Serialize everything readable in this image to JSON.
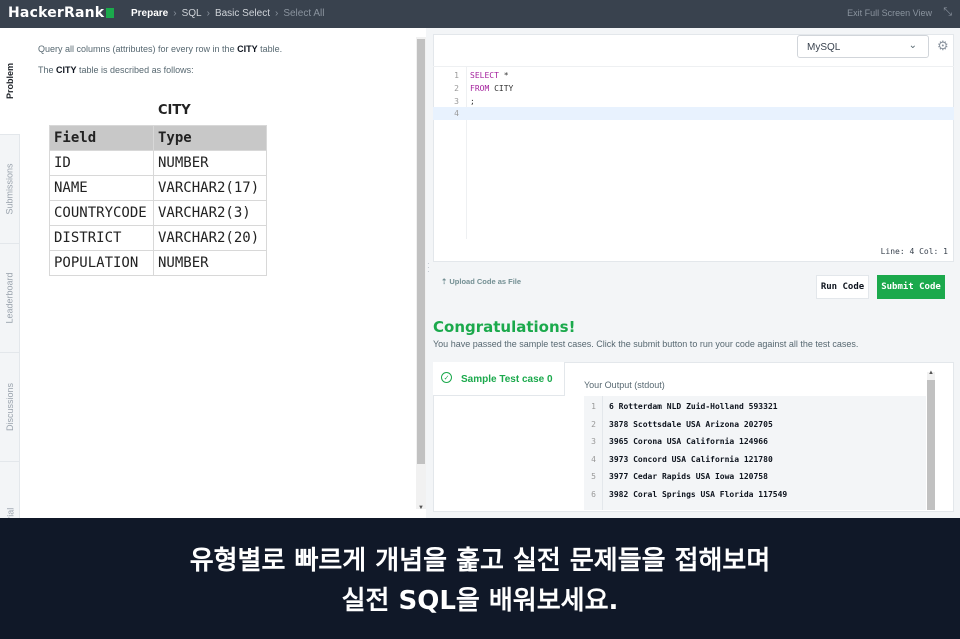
{
  "topbar": {
    "logo": "HackerRank",
    "breadcrumbs": [
      "Prepare",
      "SQL",
      "Basic Select",
      "Select All"
    ],
    "exit_label": "Exit Full Screen View"
  },
  "side_tabs": [
    "Problem",
    "Submissions",
    "Leaderboard",
    "Discussions",
    "Editorial"
  ],
  "problem": {
    "line1_pre": "Query all columns (attributes) for every row in the ",
    "line1_bold": "CITY",
    "line1_post": " table.",
    "line2_pre": "The ",
    "line2_bold": "CITY",
    "line2_post": " table is described as follows:",
    "table_title": "CITY",
    "columns": [
      "Field",
      "Type"
    ],
    "rows": [
      [
        "ID",
        "NUMBER"
      ],
      [
        "NAME",
        "VARCHAR2(17)"
      ],
      [
        "COUNTRYCODE",
        "VARCHAR2(3)"
      ],
      [
        "DISTRICT",
        "VARCHAR2(20)"
      ],
      [
        "POPULATION",
        "NUMBER"
      ]
    ]
  },
  "editor": {
    "language": "MySQL",
    "lines": [
      {
        "n": "1",
        "kw": "SELECT",
        "rest": " *"
      },
      {
        "n": "2",
        "kw": "FROM",
        "rest": " CITY"
      },
      {
        "n": "3",
        "kw": "",
        "rest": ";"
      },
      {
        "n": "4",
        "kw": "",
        "rest": ""
      }
    ],
    "status": "Line: 4 Col: 1",
    "upload_label": "Upload Code as File",
    "run_label": "Run Code",
    "submit_label": "Submit Code"
  },
  "result": {
    "title": "Congratulations!",
    "subtitle": "You have passed the sample test cases. Click the submit button to run your code against all the test cases.",
    "case_label": "Sample Test case 0",
    "output_label": "Your Output (stdout)",
    "output_lines": [
      {
        "n": "1",
        "text": "6 Rotterdam NLD Zuid-Holland 593321"
      },
      {
        "n": "2",
        "text": "3878 Scottsdale USA Arizona 202705"
      },
      {
        "n": "3",
        "text": "3965 Corona USA California 124966"
      },
      {
        "n": "4",
        "text": "3973 Concord USA California 121780"
      },
      {
        "n": "5",
        "text": "3977 Cedar Rapids USA Iowa 120758"
      },
      {
        "n": "6",
        "text": "3982 Coral Springs USA Florida 117549"
      }
    ]
  },
  "banner": {
    "line1": "유형별로 빠르게 개념을 훑고 실전 문제들을 접해보며",
    "line2": "실전 SQL을 배워보세요."
  },
  "colors": {
    "topbar": "#39424e",
    "brand_green": "#1ba94c",
    "banner": "#101828",
    "sql_keyword": "#a5239e"
  }
}
